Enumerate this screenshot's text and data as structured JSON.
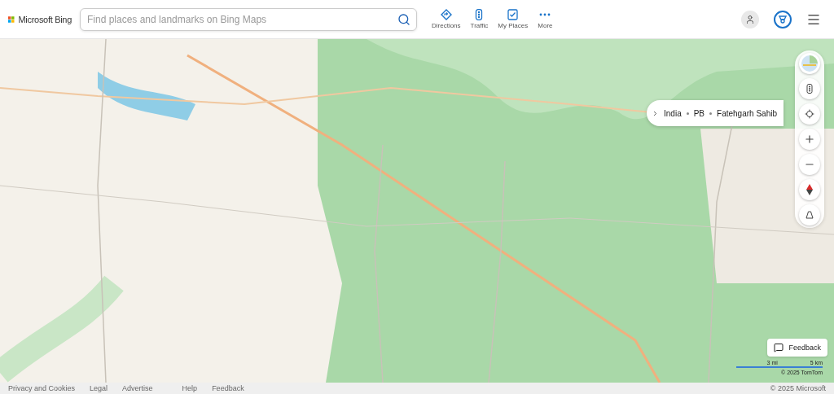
{
  "header": {
    "brand": "Microsoft Bing",
    "search": {
      "placeholder": "Find places and landmarks on Bing Maps"
    },
    "actions": [
      {
        "kind": "directions",
        "label": "Directions"
      },
      {
        "kind": "traffic",
        "label": "Traffic"
      },
      {
        "kind": "places",
        "label": "My Places"
      },
      {
        "kind": "more",
        "label": "More"
      }
    ]
  },
  "breadcrumb": [
    "India",
    "PB",
    "Fatehgarh Sahib"
  ],
  "map_controls": [
    {
      "kind": "style"
    },
    {
      "kind": "traffic"
    },
    {
      "kind": "locate"
    },
    {
      "kind": "zoom_in"
    },
    {
      "kind": "zoom_out"
    },
    {
      "kind": "compass"
    },
    {
      "kind": "tilt"
    }
  ],
  "feedback": "Feedback",
  "scale": {
    "miles": "3 mi",
    "km": "5 km"
  },
  "map_copyright": "© 2025 TomTom",
  "footer": {
    "links": [
      "Privacy and Cookies",
      "Legal",
      "Advertise",
      "Help",
      "Feedback"
    ],
    "copyright": "© 2025 Microsoft"
  }
}
